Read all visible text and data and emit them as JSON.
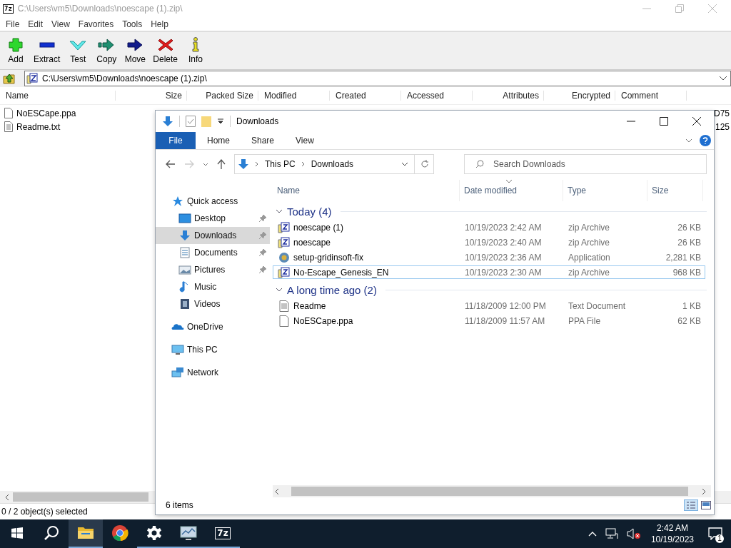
{
  "sevenzip": {
    "logo": "7z",
    "title": "C:\\Users\\vm5\\Downloads\\noescape (1).zip\\",
    "menu": [
      "File",
      "Edit",
      "View",
      "Favorites",
      "Tools",
      "Help"
    ],
    "toolbar": [
      {
        "label": "Add",
        "kind": "add"
      },
      {
        "label": "Extract",
        "kind": "extract"
      },
      {
        "label": "Test",
        "kind": "test"
      },
      {
        "label": "Copy",
        "kind": "copy"
      },
      {
        "label": "Move",
        "kind": "move"
      },
      {
        "label": "Delete",
        "kind": "delete"
      },
      {
        "label": "Info",
        "kind": "info"
      }
    ],
    "path": "C:\\Users\\vm5\\Downloads\\noescape (1).zip\\",
    "columns": [
      "Name",
      "Size",
      "Packed Size",
      "Modified",
      "Created",
      "Accessed",
      "Attributes",
      "Encrypted",
      "Comment"
    ],
    "rows": [
      {
        "kind": "file",
        "name": "NoESCape.ppa",
        "column_10": "D75"
      },
      {
        "kind": "text",
        "name": "Readme.txt",
        "column_10": "125"
      }
    ],
    "status": "0 / 2 object(s) selected"
  },
  "explorer": {
    "title": "Downloads",
    "ribbon_tabs": [
      {
        "label": "File",
        "selected": true
      },
      {
        "label": "Home",
        "selected": false
      },
      {
        "label": "Share",
        "selected": false
      },
      {
        "label": "View",
        "selected": false
      }
    ],
    "breadcrumb": [
      "This PC",
      "Downloads"
    ],
    "search": {
      "placeholder": "Search Downloads"
    },
    "nav": [
      {
        "label": "Quick access",
        "kind": "star",
        "selected": false,
        "children": [
          {
            "label": "Desktop",
            "kind": "desktop",
            "selected": false,
            "pinned": true
          },
          {
            "label": "Downloads",
            "kind": "download",
            "selected": true,
            "pinned": true
          },
          {
            "label": "Documents",
            "kind": "document",
            "selected": false,
            "pinned": true
          },
          {
            "label": "Pictures",
            "kind": "pictures",
            "selected": false,
            "pinned": true
          },
          {
            "label": "Music",
            "kind": "music",
            "selected": false,
            "pinned": false
          },
          {
            "label": "Videos",
            "kind": "videos",
            "selected": false,
            "pinned": false
          }
        ]
      },
      {
        "label": "OneDrive",
        "kind": "cloud",
        "selected": false
      },
      {
        "label": "This PC",
        "kind": "pc",
        "selected": false
      },
      {
        "label": "Network",
        "kind": "network",
        "selected": false
      }
    ],
    "columns": [
      {
        "label": "Name",
        "sorted": false
      },
      {
        "label": "Date modified",
        "sorted": true
      },
      {
        "label": "Type",
        "sorted": false
      },
      {
        "label": "Size",
        "sorted": false
      }
    ],
    "groups": [
      {
        "title": "Today (4)",
        "expanded": true,
        "files": [
          {
            "name": "noescape (1)",
            "date": "10/19/2023 2:42 AM",
            "type": "zip Archive",
            "size": "26 KB",
            "kind": "zip",
            "focused": false
          },
          {
            "name": "noescape",
            "date": "10/19/2023 2:40 AM",
            "type": "zip Archive",
            "size": "26 KB",
            "kind": "zip",
            "focused": false
          },
          {
            "name": "setup-gridinsoft-fix",
            "date": "10/19/2023 2:36 AM",
            "type": "Application",
            "size": "2,281 KB",
            "kind": "app",
            "focused": false
          },
          {
            "name": "No-Escape_Genesis_EN",
            "date": "10/19/2023 2:30 AM",
            "type": "zip Archive",
            "size": "968 KB",
            "kind": "zip",
            "focused": true
          }
        ]
      },
      {
        "title": "A long time ago (2)",
        "expanded": true,
        "files": [
          {
            "name": "Readme",
            "date": "11/18/2009 12:00 PM",
            "type": "Text Document",
            "size": "1 KB",
            "kind": "text",
            "focused": false
          },
          {
            "name": "NoESCape.ppa",
            "date": "11/18/2009 11:57 AM",
            "type": "PPA File",
            "size": "62 KB",
            "kind": "file",
            "focused": false
          }
        ]
      }
    ],
    "status": "6 items"
  },
  "taskbar": {
    "apps": [
      {
        "kind": "start",
        "running": false,
        "selected": false
      },
      {
        "kind": "search",
        "running": false,
        "selected": false
      },
      {
        "kind": "folder",
        "running": true,
        "selected": true
      },
      {
        "kind": "browser",
        "running": false,
        "selected": false
      },
      {
        "kind": "settings",
        "running": true,
        "selected": false
      },
      {
        "kind": "monitor",
        "running": true,
        "selected": false
      },
      {
        "kind": "archiver",
        "label": "7z",
        "running": true,
        "selected": false
      }
    ],
    "time": "2:42 AM",
    "date": "10/19/2023",
    "notifications": "1"
  }
}
